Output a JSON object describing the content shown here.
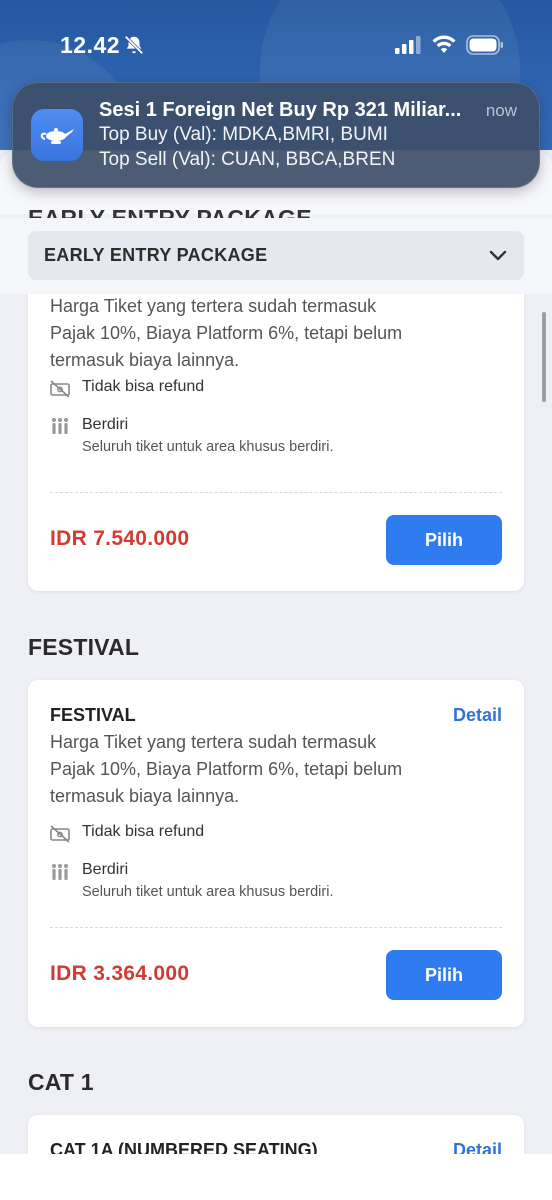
{
  "status_bar": {
    "time": "12.42"
  },
  "notification": {
    "title": "Sesi 1 Foreign Net Buy Rp 321 Miliar...",
    "time": "now",
    "line1": "Top Buy (Val): MDKA,BMRI, BUMI",
    "line2": "Top Sell (Val): CUAN, BBCA,BREN"
  },
  "ghost_title": "EARLY ENTRY PACKAGE",
  "dropdown": {
    "selected": "EARLY ENTRY PACKAGE"
  },
  "early_card": {
    "desc": "Harga Tiket yang tertera sudah termasuk Pajak 10%, Biaya Platform 6%, tetapi belum termasuk biaya lainnya.",
    "refund": "Tidak bisa refund",
    "standing": "Berdiri",
    "standing_sub": "Seluruh tiket untuk area khusus berdiri.",
    "price": "IDR 7.540.000",
    "button": "Pilih"
  },
  "festival_section": {
    "title": "FESTIVAL",
    "card": {
      "title": "FESTIVAL",
      "detail": "Detail",
      "desc": "Harga Tiket yang tertera sudah termasuk Pajak 10%, Biaya Platform 6%, tetapi belum termasuk biaya lainnya.",
      "refund": "Tidak bisa refund",
      "standing": "Berdiri",
      "standing_sub": "Seluruh tiket untuk area khusus berdiri.",
      "price": "IDR 3.364.000",
      "button": "Pilih"
    }
  },
  "cat1_section": {
    "title": "CAT 1",
    "card": {
      "title": "CAT 1A (NUMBERED SEATING)",
      "detail": "Detail"
    }
  },
  "colors": {
    "accent": "#2f7bf0",
    "price": "#d23b32",
    "link": "#2e74d8",
    "header": "#2f66b3"
  }
}
